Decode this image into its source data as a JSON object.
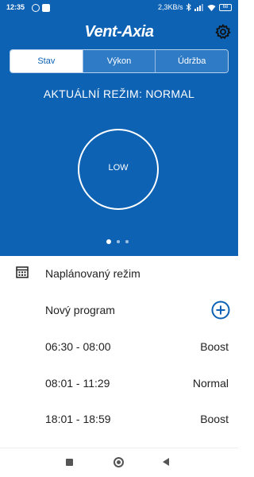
{
  "status_bar": {
    "time": "12:35",
    "speed": "2,3KB/s",
    "battery": "68"
  },
  "header": {
    "logo": "Vent-Axia"
  },
  "tabs": [
    {
      "label": "Stav",
      "active": true
    },
    {
      "label": "Výkon",
      "active": false
    },
    {
      "label": "Údržba",
      "active": false
    }
  ],
  "mode": {
    "title": "AKTUÁLNÍ REŽIM: NORMAL",
    "level": "LOW"
  },
  "pager": {
    "pages": 3,
    "active_index": 0
  },
  "schedule": {
    "title": "Naplánovaný režim",
    "new_program": "Nový program",
    "entries": [
      {
        "time": "06:30 - 08:00",
        "mode": "Boost"
      },
      {
        "time": "08:01 - 11:29",
        "mode": "Normal"
      },
      {
        "time": "18:01 - 18:59",
        "mode": "Boost"
      }
    ]
  },
  "colors": {
    "brand_blue": "#0d62b4",
    "text": "#222222"
  }
}
